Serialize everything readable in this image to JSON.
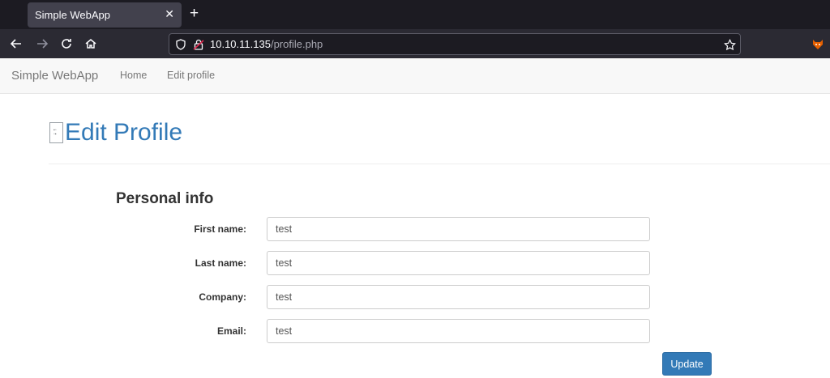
{
  "browser": {
    "tab_title": "Simple WebApp",
    "tab_close": "✕",
    "new_tab": "+",
    "url_host": "10.10.11.135",
    "url_path": "/profile.php"
  },
  "site": {
    "brand": "Simple WebApp",
    "nav": [
      {
        "label": "Home"
      },
      {
        "label": "Edit profile"
      }
    ]
  },
  "page": {
    "title": "Edit Profile",
    "section_title": "Personal info",
    "fields": [
      {
        "label": "First name:",
        "value": "test"
      },
      {
        "label": "Last name:",
        "value": "test"
      },
      {
        "label": "Company:",
        "value": "test"
      },
      {
        "label": "Email:",
        "value": "test"
      }
    ],
    "submit_label": "Update"
  },
  "colors": {
    "accent": "#337ab7",
    "chrome_dark": "#1c1b22",
    "toolbar": "#2b2a33"
  }
}
